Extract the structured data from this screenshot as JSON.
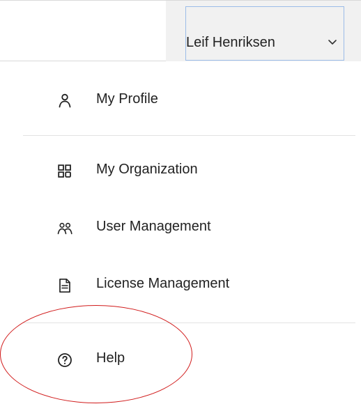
{
  "header": {
    "user_name": "Leif Henriksen",
    "dropdown_icon": "chevron-down-icon"
  },
  "menu": {
    "items": [
      {
        "label": "My Profile",
        "icon": "user-icon"
      },
      {
        "label": "My Organization",
        "icon": "grid-icon"
      },
      {
        "label": "User Management",
        "icon": "users-icon"
      },
      {
        "label": "License Management",
        "icon": "document-icon"
      },
      {
        "label": "Help",
        "icon": "help-circle-icon"
      }
    ]
  },
  "colors": {
    "text": "#222222",
    "divider": "#e2e2e2",
    "button_border": "#9bbce8",
    "button_bg": "#f1f1f1",
    "annotation": "#d11b1b"
  }
}
